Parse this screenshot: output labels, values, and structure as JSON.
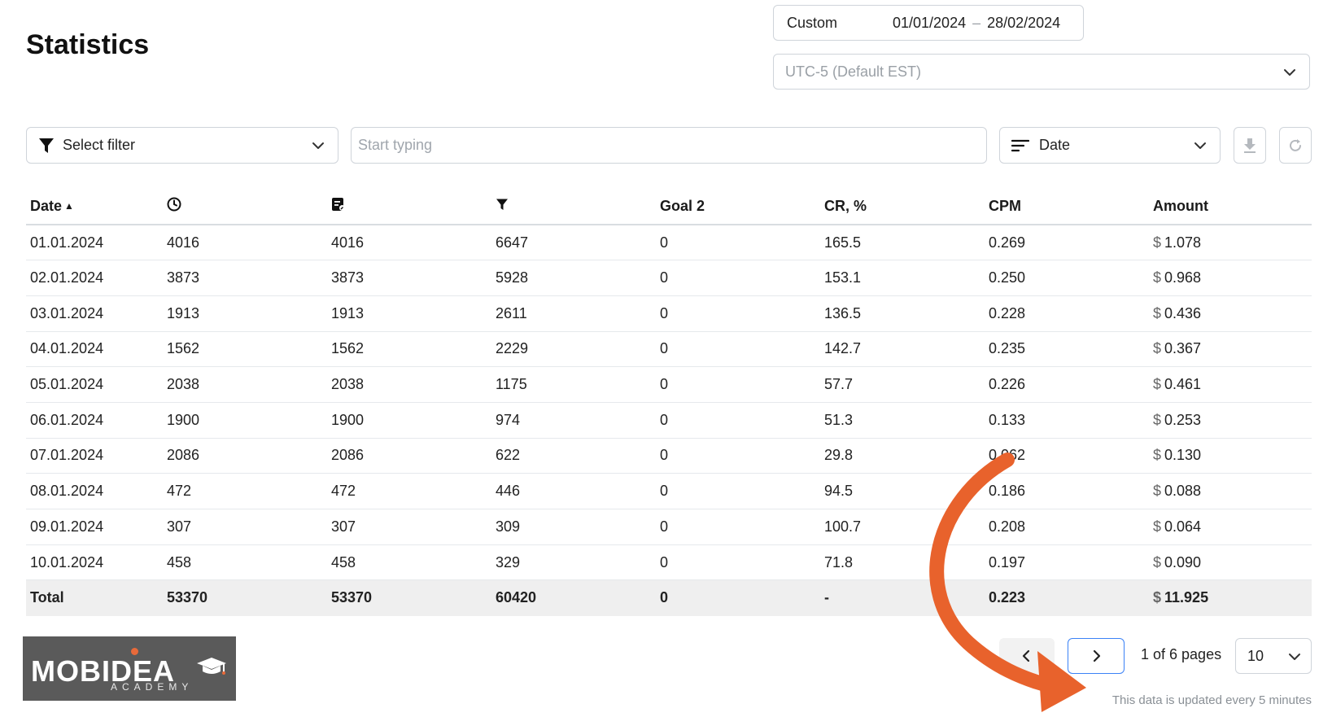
{
  "page": {
    "title": "Statistics"
  },
  "date_range": {
    "preset": "Custom",
    "from": "01/01/2024",
    "separator": "–",
    "to": "28/02/2024"
  },
  "timezone": {
    "value": "UTC-5 (Default EST)"
  },
  "toolbar": {
    "filter_label": "Select filter",
    "search_placeholder": "Start typing",
    "sort_label": "Date"
  },
  "table": {
    "headers": {
      "date": "Date",
      "goal2": "Goal 2",
      "cr": "CR, %",
      "cpm": "CPM",
      "amount": "Amount"
    },
    "currency": "$",
    "rows": [
      {
        "date": "01.01.2024",
        "c1": "4016",
        "c2": "4016",
        "c3": "6647",
        "goal2": "0",
        "cr": "165.5",
        "cpm": "0.269",
        "amount": "1.078"
      },
      {
        "date": "02.01.2024",
        "c1": "3873",
        "c2": "3873",
        "c3": "5928",
        "goal2": "0",
        "cr": "153.1",
        "cpm": "0.250",
        "amount": "0.968"
      },
      {
        "date": "03.01.2024",
        "c1": "1913",
        "c2": "1913",
        "c3": "2611",
        "goal2": "0",
        "cr": "136.5",
        "cpm": "0.228",
        "amount": "0.436"
      },
      {
        "date": "04.01.2024",
        "c1": "1562",
        "c2": "1562",
        "c3": "2229",
        "goal2": "0",
        "cr": "142.7",
        "cpm": "0.235",
        "amount": "0.367"
      },
      {
        "date": "05.01.2024",
        "c1": "2038",
        "c2": "2038",
        "c3": "1175",
        "goal2": "0",
        "cr": "57.7",
        "cpm": "0.226",
        "amount": "0.461"
      },
      {
        "date": "06.01.2024",
        "c1": "1900",
        "c2": "1900",
        "c3": "974",
        "goal2": "0",
        "cr": "51.3",
        "cpm": "0.133",
        "amount": "0.253"
      },
      {
        "date": "07.01.2024",
        "c1": "2086",
        "c2": "2086",
        "c3": "622",
        "goal2": "0",
        "cr": "29.8",
        "cpm": "0.062",
        "amount": "0.130"
      },
      {
        "date": "08.01.2024",
        "c1": "472",
        "c2": "472",
        "c3": "446",
        "goal2": "0",
        "cr": "94.5",
        "cpm": "0.186",
        "amount": "0.088"
      },
      {
        "date": "09.01.2024",
        "c1": "307",
        "c2": "307",
        "c3": "309",
        "goal2": "0",
        "cr": "100.7",
        "cpm": "0.208",
        "amount": "0.064"
      },
      {
        "date": "10.01.2024",
        "c1": "458",
        "c2": "458",
        "c3": "329",
        "goal2": "0",
        "cr": "71.8",
        "cpm": "0.197",
        "amount": "0.090"
      }
    ],
    "total": {
      "label": "Total",
      "c1": "53370",
      "c2": "53370",
      "c3": "60420",
      "goal2": "0",
      "cr": "-",
      "cpm": "0.223",
      "amount": "11.925"
    }
  },
  "pagination": {
    "info": "1 of 6 pages",
    "per_page": "10"
  },
  "footer": {
    "update_note": "This data is updated every 5 minutes"
  },
  "logo": {
    "word": "MOBIDEA",
    "sub": "ACADEMY"
  },
  "colors": {
    "accent": "#3b82f6",
    "annotation_arrow": "#e8622c",
    "logo_bg": "#5a5a5a"
  }
}
